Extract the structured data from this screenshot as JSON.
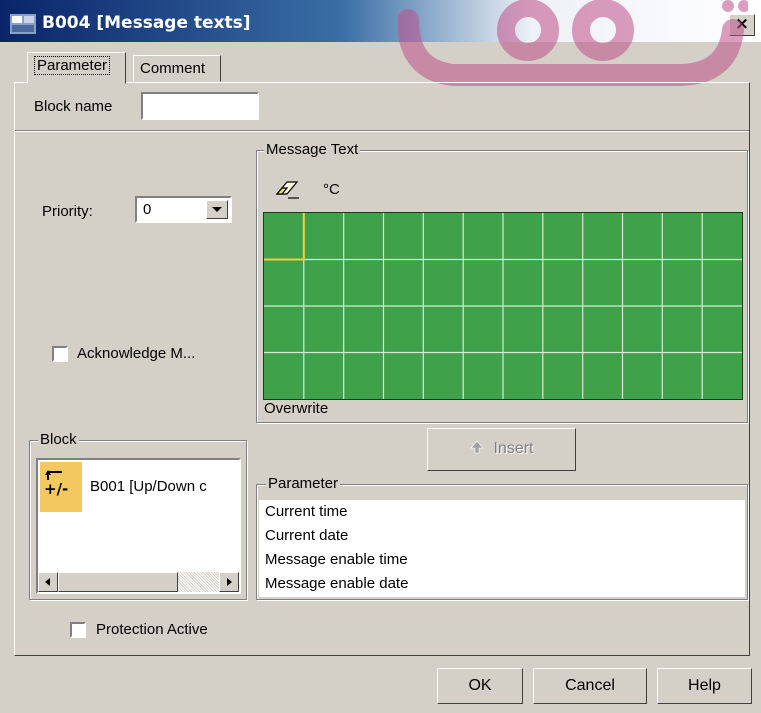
{
  "window": {
    "title": "B004 [Message texts]",
    "close_glyph": "×",
    "icon": "block-icon"
  },
  "tabs": [
    {
      "label": "Parameter",
      "active": true
    },
    {
      "label": "Comment",
      "active": false
    }
  ],
  "block_name": {
    "label": "Block name",
    "value": ""
  },
  "priority": {
    "label": "Priority:",
    "value": "0"
  },
  "acknowledge": {
    "label": "Acknowledge M...",
    "checked": false
  },
  "block_group": {
    "title": "Block",
    "items": [
      {
        "icon": "up-down-counter-icon",
        "icon_text": "+/-",
        "label": "B001 [Up/Down c"
      }
    ]
  },
  "protection": {
    "label": "Protection Active",
    "checked": false
  },
  "message_text": {
    "title": "Message Text",
    "degree_label": "°C",
    "mode_label": "Overwrite",
    "grid": {
      "columns": 12,
      "rows": 4,
      "selected_cell": [
        0,
        0
      ],
      "color": "#3fa14a"
    }
  },
  "insert_button": {
    "label": "Insert",
    "enabled": false
  },
  "parameter_group": {
    "title": "Parameter",
    "items": [
      "Current time",
      "Current date",
      "Message enable time",
      "Message enable date"
    ]
  },
  "footer": {
    "ok": "OK",
    "cancel": "Cancel",
    "help": "Help"
  },
  "watermark": {
    "line1": "توشه",
    "line2": "برای موفقیت",
    "color": "#c0508a"
  }
}
